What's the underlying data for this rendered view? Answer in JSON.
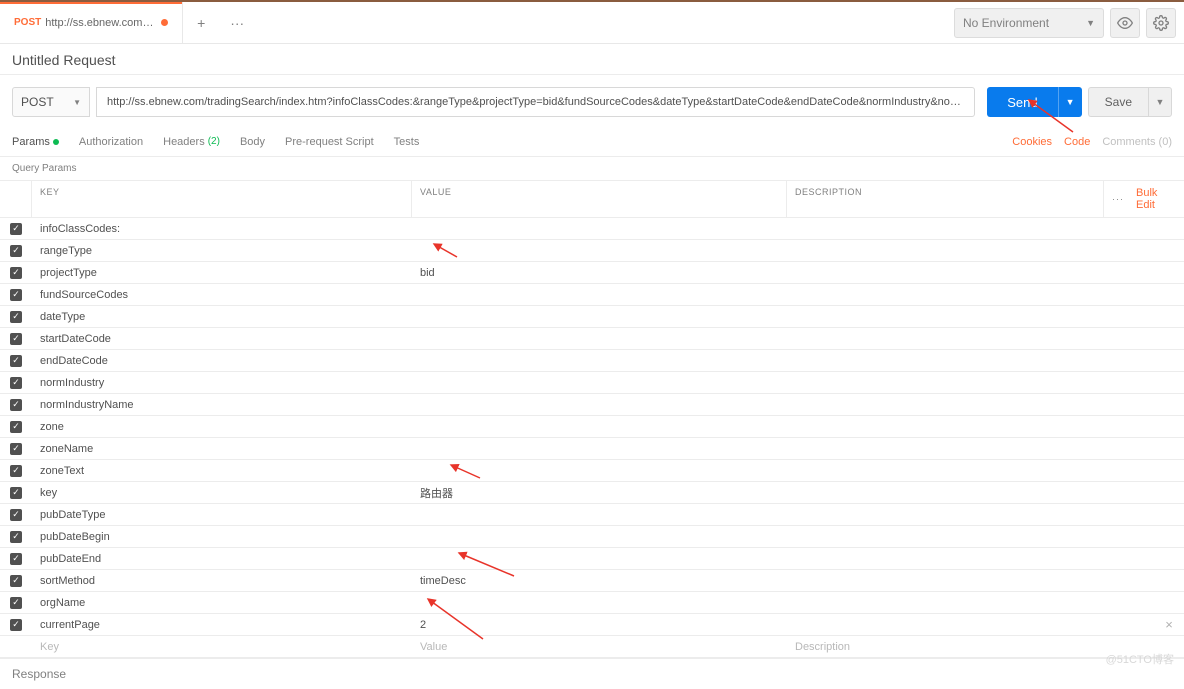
{
  "brown_bar": true,
  "tab": {
    "method": "POST",
    "title": "http://ss.ebnew.com/tradingS..."
  },
  "environment": "No Environment",
  "request_title": "Untitled Request",
  "method": "POST",
  "url": "http://ss.ebnew.com/tradingSearch/index.htm?infoClassCodes:&rangeType&projectType=bid&fundSourceCodes&dateType&startDateCode&endDateCode&normIndustry&normIndustryName&zone&zoneName&zoneText&key=...",
  "buttons": {
    "send": "Send",
    "save": "Save"
  },
  "sub_tabs": {
    "params": "Params",
    "authorization": "Authorization",
    "headers": "Headers",
    "headers_count": "(2)",
    "body": "Body",
    "prerequest": "Pre-request Script",
    "tests": "Tests"
  },
  "right_links": {
    "cookies": "Cookies",
    "code": "Code",
    "comments": "Comments (0)"
  },
  "query_params_label": "Query Params",
  "table_headers": {
    "key": "KEY",
    "value": "VALUE",
    "description": "DESCRIPTION"
  },
  "bulk_edit": "Bulk Edit",
  "params": [
    {
      "key": "infoClassCodes:",
      "value": "",
      "checked": true
    },
    {
      "key": "rangeType",
      "value": "",
      "checked": true
    },
    {
      "key": "projectType",
      "value": "bid",
      "checked": true,
      "arrow": true
    },
    {
      "key": "fundSourceCodes",
      "value": "",
      "checked": true
    },
    {
      "key": "dateType",
      "value": "",
      "checked": true
    },
    {
      "key": "startDateCode",
      "value": "",
      "checked": true
    },
    {
      "key": "endDateCode",
      "value": "",
      "checked": true
    },
    {
      "key": "normIndustry",
      "value": "",
      "checked": true
    },
    {
      "key": "normIndustryName",
      "value": "",
      "checked": true
    },
    {
      "key": "zone",
      "value": "",
      "checked": true
    },
    {
      "key": "zoneName",
      "value": "",
      "checked": true
    },
    {
      "key": "zoneText",
      "value": "",
      "checked": true
    },
    {
      "key": "key",
      "value": "路由器",
      "checked": true,
      "arrow": true
    },
    {
      "key": "pubDateType",
      "value": "",
      "checked": true
    },
    {
      "key": "pubDateBegin",
      "value": "",
      "checked": true
    },
    {
      "key": "pubDateEnd",
      "value": "",
      "checked": true
    },
    {
      "key": "sortMethod",
      "value": "timeDesc",
      "checked": true,
      "arrow": true
    },
    {
      "key": "orgName",
      "value": "",
      "checked": true
    },
    {
      "key": "currentPage",
      "value": "2",
      "checked": true,
      "arrow": true,
      "handle": true,
      "closable": true
    }
  ],
  "placeholder_row": {
    "key": "Key",
    "value": "Value",
    "description": "Description"
  },
  "response": "Response",
  "watermark": "@51CTO博客"
}
